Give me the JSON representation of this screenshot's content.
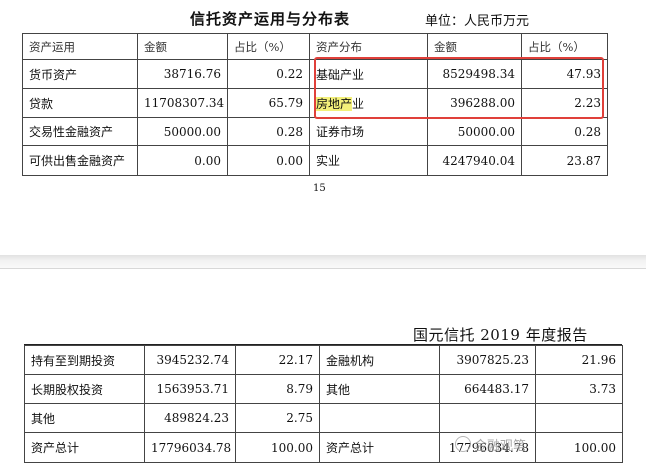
{
  "doc": {
    "title": "信托资产运用与分布表",
    "unit": "单位：人民币万元",
    "page_number": "15",
    "report_header": "国元信托 2019 年度报告",
    "watermark": "金融观笔"
  },
  "table1": {
    "headers": [
      "资产运用",
      "金额",
      "占比（%）",
      "资产分布",
      "金额",
      "占比（%）"
    ],
    "rows": [
      [
        "货币资产",
        "38716.76",
        "0.22",
        "基础产业",
        "8529498.34",
        "47.93"
      ],
      [
        "贷款",
        "11708307.34",
        "65.79",
        "房地产业",
        "396288.00",
        "2.23"
      ],
      [
        "交易性金融资产",
        "50000.00",
        "0.28",
        "证券市场",
        "50000.00",
        "0.28"
      ],
      [
        "可供出售金融资产",
        "0.00",
        "0.00",
        "实业",
        "4247940.04",
        "23.87"
      ]
    ],
    "highlight_text": "房地产"
  },
  "table2": {
    "rows": [
      [
        "持有至到期投资",
        "3945232.74",
        "22.17",
        "金融机构",
        "3907825.23",
        "21.96"
      ],
      [
        "长期股权投资",
        "1563953.71",
        "8.79",
        "其他",
        "664483.17",
        "3.73"
      ],
      [
        "其他",
        "489824.23",
        "2.75",
        "",
        "",
        ""
      ],
      [
        "资产总计",
        "17796034.78",
        "100.00",
        "资产总计",
        "17796034.78",
        "100.00"
      ]
    ]
  },
  "colors": {
    "annotation_box": "#e0403a",
    "highlight": "#f3f07a"
  }
}
